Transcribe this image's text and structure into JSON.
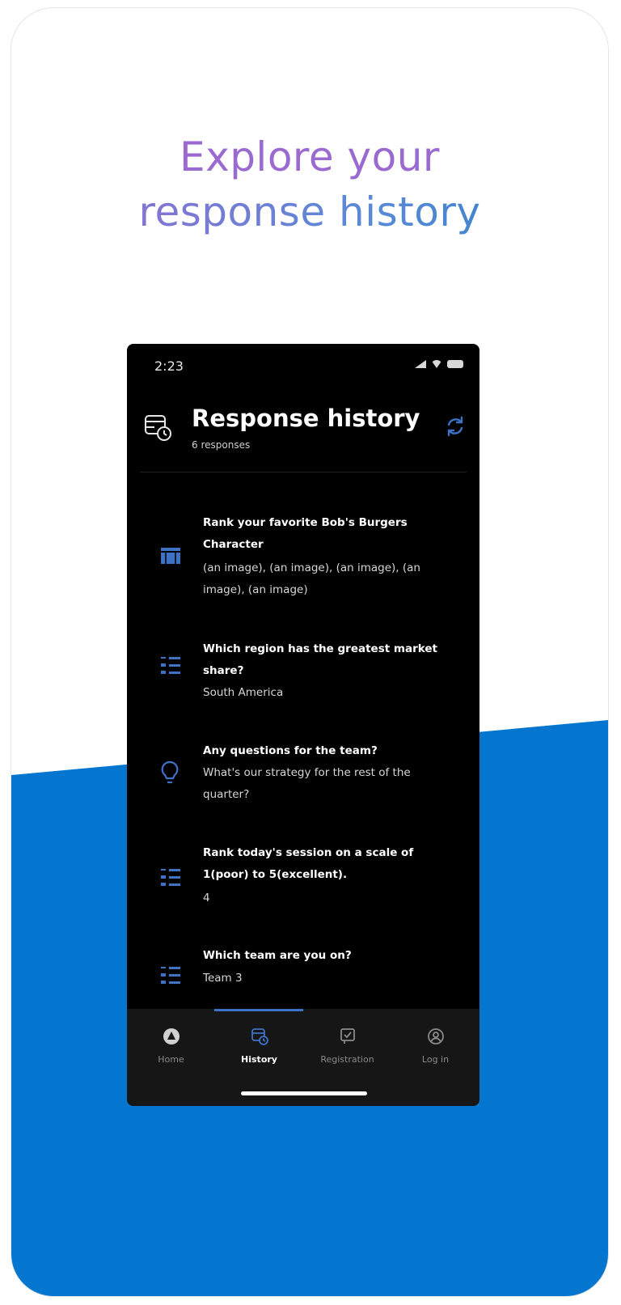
{
  "headline": {
    "line1": "Explore your",
    "line2": "response history"
  },
  "colors": {
    "accent_blue": "#0576cf",
    "headline_purple": "#9b6ad0",
    "icon_blue": "#3d72c4"
  },
  "phone": {
    "status_time": "2:23",
    "header": {
      "title": "Response history",
      "subtitle": "6 responses",
      "icon": "history-icon",
      "refresh_icon": "refresh-icon"
    },
    "responses": [
      {
        "question": "Rank your favorite Bob's Burgers Character",
        "answer": "(an image), (an image), (an image), (an image), (an image)",
        "icon": "ranking-icon"
      },
      {
        "question": "Which region has the greatest market share?",
        "answer": "South America",
        "icon": "multiple-choice-icon"
      },
      {
        "question": "Any questions for the team?",
        "answer": "What's our strategy for the rest of the quarter?",
        "icon": "lightbulb-icon"
      },
      {
        "question": "Rank today's session on a scale of 1(poor) to 5(excellent).",
        "answer": "4",
        "icon": "multiple-choice-icon"
      },
      {
        "question": "Which team are you on?",
        "answer": "Team 3",
        "icon": "multiple-choice-icon"
      }
    ],
    "tabs": [
      {
        "label": "Home",
        "icon": "home-icon",
        "active": false
      },
      {
        "label": "History",
        "icon": "history-icon",
        "active": true
      },
      {
        "label": "Registration",
        "icon": "registration-icon",
        "active": false
      },
      {
        "label": "Log in",
        "icon": "login-icon",
        "active": false
      }
    ]
  }
}
